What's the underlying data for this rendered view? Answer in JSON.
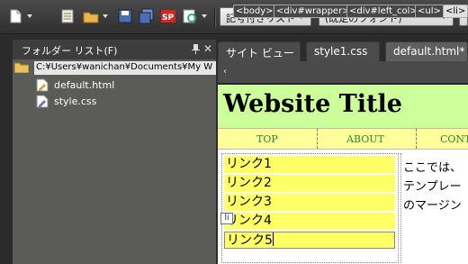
{
  "toolbar": {
    "style_combo": "記号付きリスト",
    "font_combo": "(既定のフォント)"
  },
  "folder_panel": {
    "title": "フォルダー リスト(F)",
    "close": "✕",
    "root_path": "C:¥Users¥wanichan¥Documents¥My W",
    "files": [
      "default.html",
      "style.css"
    ]
  },
  "tabs": [
    "サイト ビュー",
    "style1.css",
    "default.html*"
  ],
  "tag_path": [
    "<body>",
    "<div#wrapper>",
    "<div#left_col>",
    "<ul>",
    "<li>"
  ],
  "site": {
    "title": "Website Title",
    "nav": [
      "TOP",
      "ABOUT",
      "CONT"
    ],
    "links": [
      "リンク1",
      "リンク2",
      "リンク3",
      "リンク4",
      "リンク5"
    ],
    "li_badge": "li",
    "content_lines": [
      "ここでは、",
      "テンプレー",
      "のマージン"
    ]
  },
  "colors": {
    "header_bg": "#ccff99",
    "nav_bg": "#ffff99",
    "link_bg": "#ffff66",
    "nav_text": "#2a8a2a"
  }
}
